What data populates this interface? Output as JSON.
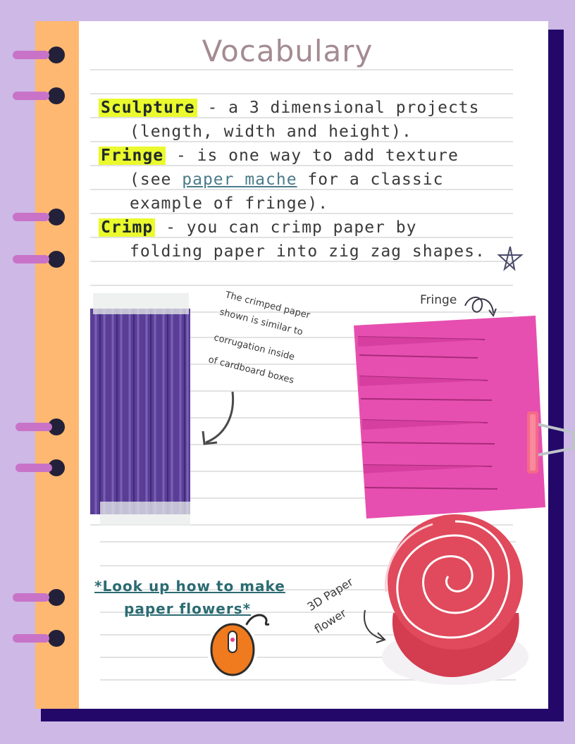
{
  "title": "Vocabulary",
  "vocab": {
    "line1_term": "Sculpture",
    "line1_rest": " - a 3 dimensional projects",
    "line2": "(length, width and height).",
    "line3_term": "Fringe",
    "line3_rest": " - is one way to add texture",
    "line4_pre": "(see ",
    "line4_link": "paper mache",
    "line4_post": " for a classic",
    "line5": "example of fringe).",
    "line6_term": "Crimp",
    "line6_rest": " - you can crimp paper by",
    "line7": "folding paper into zig zag shapes."
  },
  "notes": {
    "crimp_1": "The crimped paper",
    "crimp_2": "shown is similar to",
    "crimp_3": "corrugation inside",
    "crimp_4": "of cardboard boxes",
    "fringe_label": "Fringe",
    "flower_1": "3D Paper",
    "flower_2": "flower"
  },
  "flower_link": {
    "line1": "*Look up how to make",
    "line2": "paper flowers*"
  },
  "colors": {
    "background": "#cdb8e6",
    "spine": "#ffb871",
    "highlight": "#eafa2c",
    "page_shadow": "#23086a",
    "ring": "#c873c8",
    "fringe_paper": "#e64fb0",
    "crimp_paper": "#5a3e96"
  },
  "icons": {
    "star": "star-doodle-icon",
    "mouse": "computer-mouse-icon",
    "clip": "binder-clip-icon"
  }
}
